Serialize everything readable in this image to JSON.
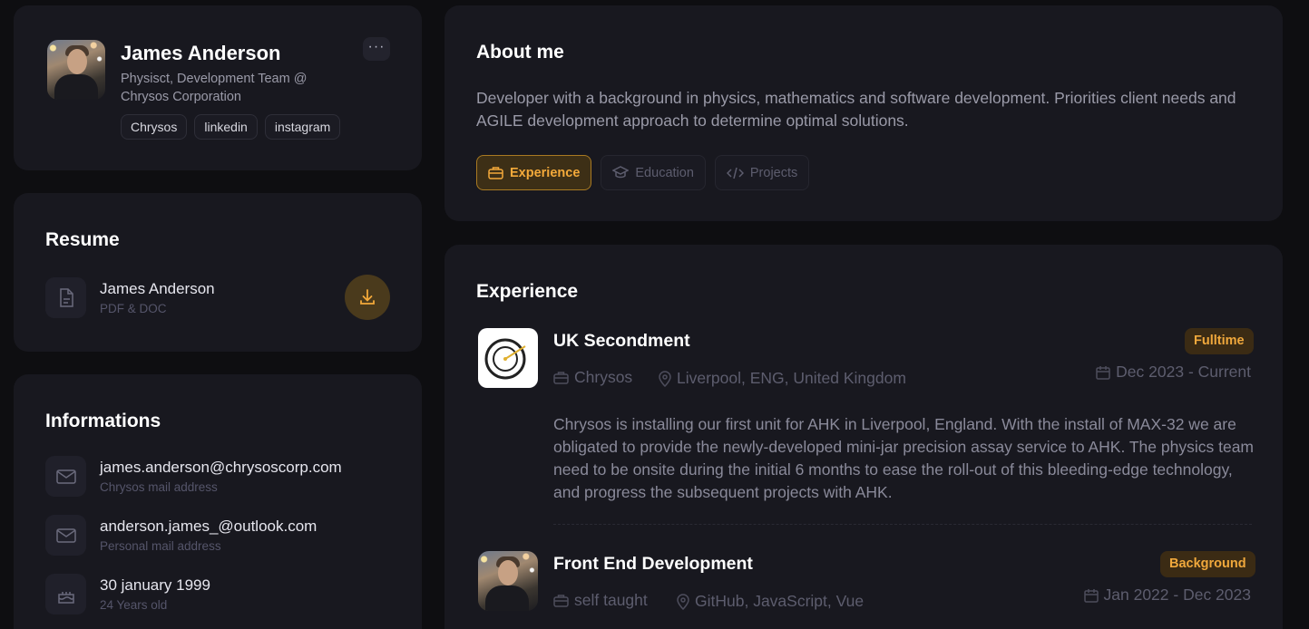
{
  "profile": {
    "name": "James Anderson",
    "title": "Physisct, Development Team @ Chrysos Corporation",
    "more_label": "···",
    "links": [
      "Chrysos",
      "linkedin",
      "instagram"
    ]
  },
  "resume": {
    "title": "Resume",
    "file_name": "James Anderson",
    "file_type": "PDF & DOC"
  },
  "info": {
    "title": "Informations",
    "items": [
      {
        "value": "james.anderson@chrysoscorp.com",
        "label": "Chrysos mail address",
        "icon": "mail-icon"
      },
      {
        "value": "anderson.james_@outlook.com",
        "label": "Personal mail address",
        "icon": "mail-icon"
      },
      {
        "value": "30 january 1999",
        "label": "24 Years old",
        "icon": "cake-icon"
      }
    ]
  },
  "about": {
    "title": "About me",
    "text": "Developer with a background in physics, mathematics and software development. Priorities client needs and AGILE development approach to determine optimal solutions.",
    "tabs": [
      {
        "label": "Experience",
        "active": true,
        "icon": "briefcase-icon"
      },
      {
        "label": "Education",
        "active": false,
        "icon": "graduation-cap-icon"
      },
      {
        "label": "Projects",
        "active": false,
        "icon": "code-icon"
      }
    ]
  },
  "experience": {
    "title": "Experience",
    "jobs": [
      {
        "title": "UK Secondment",
        "company": "Chrysos",
        "location": "Liverpool, ENG, United Kingdom",
        "badge": "Fulltime",
        "dates": "Dec 2023 - Current",
        "description": "Chrysos is installing our first unit for AHK in Liverpool, England. With the install of MAX-32 we are obligated to provide the newly-developed mini-jar precision assay service to AHK. The physics team need to be onsite during the initial 6 months to ease the roll-out of this bleeding-edge technology, and progress the subsequent projects with AHK."
      },
      {
        "title": "Front End Development",
        "company": "self taught",
        "location": "GitHub, JavaScript, Vue",
        "badge": "Background",
        "dates": "Jan 2022 - Dec 2023"
      }
    ]
  },
  "colors": {
    "background": "#0e0e11",
    "card": "#18181f",
    "accent": "#f3a93a",
    "muted_text": "#9a9aa8"
  }
}
